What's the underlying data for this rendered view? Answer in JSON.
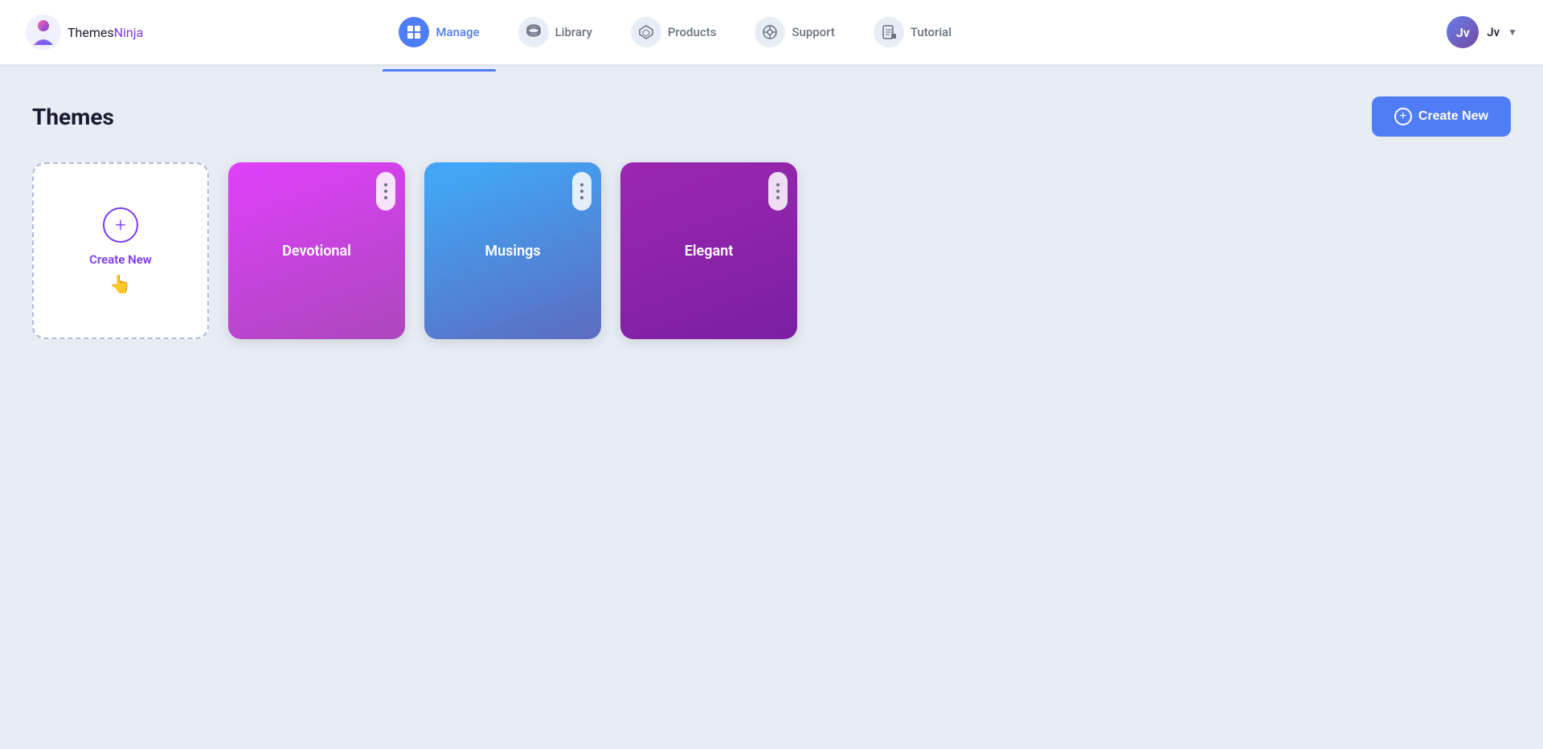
{
  "app": {
    "logo": {
      "themes": "Themes",
      "ninja": "Ninja"
    }
  },
  "nav": {
    "items": [
      {
        "id": "manage",
        "label": "Manage",
        "active": true,
        "icon": "🗂"
      },
      {
        "id": "library",
        "label": "Library",
        "active": false,
        "icon": "📚"
      },
      {
        "id": "products",
        "label": "Products",
        "active": false,
        "icon": "📦"
      },
      {
        "id": "support",
        "label": "Support",
        "active": false,
        "icon": "💬"
      },
      {
        "id": "tutorial",
        "label": "Tutorial",
        "active": false,
        "icon": "📖"
      }
    ]
  },
  "user": {
    "name": "Jv",
    "initials": "Jv"
  },
  "page": {
    "title": "Themes"
  },
  "header_button": {
    "label": "Create New"
  },
  "create_card": {
    "label": "Create New",
    "cursor": "👆"
  },
  "theme_cards": [
    {
      "id": "devotional",
      "label": "Devotional",
      "color_class": "card-devotional"
    },
    {
      "id": "musings",
      "label": "Musings",
      "color_class": "card-musings"
    },
    {
      "id": "elegant",
      "label": "Elegant",
      "color_class": "card-elegant"
    }
  ]
}
